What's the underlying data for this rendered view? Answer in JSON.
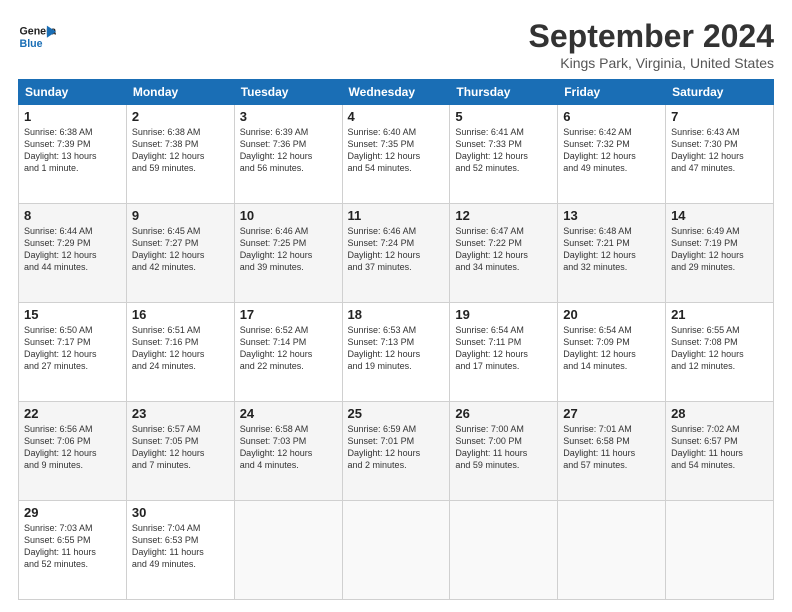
{
  "header": {
    "logo_line1": "General",
    "logo_line2": "Blue",
    "month": "September 2024",
    "location": "Kings Park, Virginia, United States"
  },
  "days_of_week": [
    "Sunday",
    "Monday",
    "Tuesday",
    "Wednesday",
    "Thursday",
    "Friday",
    "Saturday"
  ],
  "weeks": [
    [
      {
        "day": "1",
        "lines": [
          "Sunrise: 6:38 AM",
          "Sunset: 7:39 PM",
          "Daylight: 13 hours",
          "and 1 minute."
        ]
      },
      {
        "day": "2",
        "lines": [
          "Sunrise: 6:38 AM",
          "Sunset: 7:38 PM",
          "Daylight: 12 hours",
          "and 59 minutes."
        ]
      },
      {
        "day": "3",
        "lines": [
          "Sunrise: 6:39 AM",
          "Sunset: 7:36 PM",
          "Daylight: 12 hours",
          "and 56 minutes."
        ]
      },
      {
        "day": "4",
        "lines": [
          "Sunrise: 6:40 AM",
          "Sunset: 7:35 PM",
          "Daylight: 12 hours",
          "and 54 minutes."
        ]
      },
      {
        "day": "5",
        "lines": [
          "Sunrise: 6:41 AM",
          "Sunset: 7:33 PM",
          "Daylight: 12 hours",
          "and 52 minutes."
        ]
      },
      {
        "day": "6",
        "lines": [
          "Sunrise: 6:42 AM",
          "Sunset: 7:32 PM",
          "Daylight: 12 hours",
          "and 49 minutes."
        ]
      },
      {
        "day": "7",
        "lines": [
          "Sunrise: 6:43 AM",
          "Sunset: 7:30 PM",
          "Daylight: 12 hours",
          "and 47 minutes."
        ]
      }
    ],
    [
      {
        "day": "8",
        "lines": [
          "Sunrise: 6:44 AM",
          "Sunset: 7:29 PM",
          "Daylight: 12 hours",
          "and 44 minutes."
        ]
      },
      {
        "day": "9",
        "lines": [
          "Sunrise: 6:45 AM",
          "Sunset: 7:27 PM",
          "Daylight: 12 hours",
          "and 42 minutes."
        ]
      },
      {
        "day": "10",
        "lines": [
          "Sunrise: 6:46 AM",
          "Sunset: 7:25 PM",
          "Daylight: 12 hours",
          "and 39 minutes."
        ]
      },
      {
        "day": "11",
        "lines": [
          "Sunrise: 6:46 AM",
          "Sunset: 7:24 PM",
          "Daylight: 12 hours",
          "and 37 minutes."
        ]
      },
      {
        "day": "12",
        "lines": [
          "Sunrise: 6:47 AM",
          "Sunset: 7:22 PM",
          "Daylight: 12 hours",
          "and 34 minutes."
        ]
      },
      {
        "day": "13",
        "lines": [
          "Sunrise: 6:48 AM",
          "Sunset: 7:21 PM",
          "Daylight: 12 hours",
          "and 32 minutes."
        ]
      },
      {
        "day": "14",
        "lines": [
          "Sunrise: 6:49 AM",
          "Sunset: 7:19 PM",
          "Daylight: 12 hours",
          "and 29 minutes."
        ]
      }
    ],
    [
      {
        "day": "15",
        "lines": [
          "Sunrise: 6:50 AM",
          "Sunset: 7:17 PM",
          "Daylight: 12 hours",
          "and 27 minutes."
        ]
      },
      {
        "day": "16",
        "lines": [
          "Sunrise: 6:51 AM",
          "Sunset: 7:16 PM",
          "Daylight: 12 hours",
          "and 24 minutes."
        ]
      },
      {
        "day": "17",
        "lines": [
          "Sunrise: 6:52 AM",
          "Sunset: 7:14 PM",
          "Daylight: 12 hours",
          "and 22 minutes."
        ]
      },
      {
        "day": "18",
        "lines": [
          "Sunrise: 6:53 AM",
          "Sunset: 7:13 PM",
          "Daylight: 12 hours",
          "and 19 minutes."
        ]
      },
      {
        "day": "19",
        "lines": [
          "Sunrise: 6:54 AM",
          "Sunset: 7:11 PM",
          "Daylight: 12 hours",
          "and 17 minutes."
        ]
      },
      {
        "day": "20",
        "lines": [
          "Sunrise: 6:54 AM",
          "Sunset: 7:09 PM",
          "Daylight: 12 hours",
          "and 14 minutes."
        ]
      },
      {
        "day": "21",
        "lines": [
          "Sunrise: 6:55 AM",
          "Sunset: 7:08 PM",
          "Daylight: 12 hours",
          "and 12 minutes."
        ]
      }
    ],
    [
      {
        "day": "22",
        "lines": [
          "Sunrise: 6:56 AM",
          "Sunset: 7:06 PM",
          "Daylight: 12 hours",
          "and 9 minutes."
        ]
      },
      {
        "day": "23",
        "lines": [
          "Sunrise: 6:57 AM",
          "Sunset: 7:05 PM",
          "Daylight: 12 hours",
          "and 7 minutes."
        ]
      },
      {
        "day": "24",
        "lines": [
          "Sunrise: 6:58 AM",
          "Sunset: 7:03 PM",
          "Daylight: 12 hours",
          "and 4 minutes."
        ]
      },
      {
        "day": "25",
        "lines": [
          "Sunrise: 6:59 AM",
          "Sunset: 7:01 PM",
          "Daylight: 12 hours",
          "and 2 minutes."
        ]
      },
      {
        "day": "26",
        "lines": [
          "Sunrise: 7:00 AM",
          "Sunset: 7:00 PM",
          "Daylight: 11 hours",
          "and 59 minutes."
        ]
      },
      {
        "day": "27",
        "lines": [
          "Sunrise: 7:01 AM",
          "Sunset: 6:58 PM",
          "Daylight: 11 hours",
          "and 57 minutes."
        ]
      },
      {
        "day": "28",
        "lines": [
          "Sunrise: 7:02 AM",
          "Sunset: 6:57 PM",
          "Daylight: 11 hours",
          "and 54 minutes."
        ]
      }
    ],
    [
      {
        "day": "29",
        "lines": [
          "Sunrise: 7:03 AM",
          "Sunset: 6:55 PM",
          "Daylight: 11 hours",
          "and 52 minutes."
        ]
      },
      {
        "day": "30",
        "lines": [
          "Sunrise: 7:04 AM",
          "Sunset: 6:53 PM",
          "Daylight: 11 hours",
          "and 49 minutes."
        ]
      },
      {
        "day": "",
        "lines": []
      },
      {
        "day": "",
        "lines": []
      },
      {
        "day": "",
        "lines": []
      },
      {
        "day": "",
        "lines": []
      },
      {
        "day": "",
        "lines": []
      }
    ]
  ]
}
